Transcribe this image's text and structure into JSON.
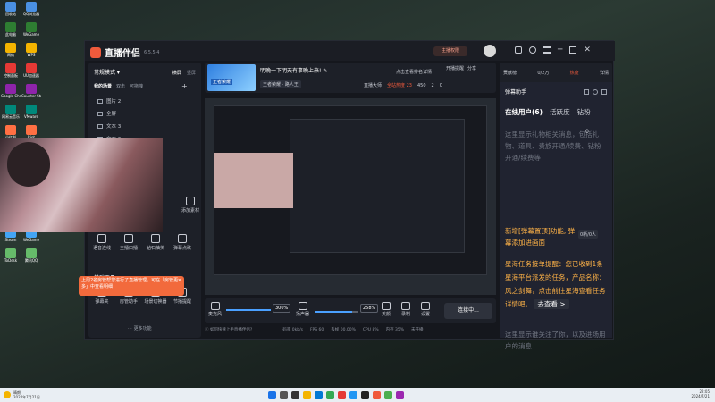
{
  "desktop": {
    "col1": [
      "回收站",
      "此电脑",
      "网络",
      "控制面板",
      "Google Chrome",
      "网易云音乐",
      "小红书",
      "Logitech G HUB",
      "Microsoft Edge",
      "OBS Studio",
      "QQ音乐",
      "Steam",
      "ToDesk"
    ],
    "col2": [
      "QQ浏览器",
      "WeGame",
      "WPS",
      "UU加速器",
      "Counter-Strike",
      "VMware",
      "Riot",
      "TUR2X RX",
      "腾讯会议",
      "Ai2Bridge",
      "Arknights",
      "WeGame",
      "腾讯QQ"
    ]
  },
  "app": {
    "logo": "直播伴侣",
    "version": "6.5.5.4",
    "top_btn": "主播权限",
    "mode_label": "常规模式",
    "orient": {
      "h": "横屏",
      "v": "竖屏"
    },
    "scene_tabs": [
      "我的场景",
      "双击",
      "可拖拽"
    ],
    "scenes": [
      {
        "name": "图片 2"
      },
      {
        "name": "全屏"
      },
      {
        "name": "文本 3"
      },
      {
        "name": "文本 2"
      }
    ],
    "add_source": "添加素材",
    "toolbox_row1": [
      "语音连线",
      "主播口播",
      "钻石抽奖",
      "弹幕点歌"
    ],
    "tools_header": "基础工具",
    "toolbox_row2": [
      "弹幕夹",
      "房管助手",
      "场景切换器",
      "节播提醒"
    ],
    "more_features": "更多功能",
    "notice": "上周2名房管帮您进行了直播管理，可在「房管更多」中查看明细",
    "stream": {
      "title": "明晚一下明天有事晚上来!",
      "game": "王者荣耀 · 路人王",
      "thumb_tag": "王者荣耀",
      "notify": "点击查看排名详情",
      "actions": [
        "开播提醒",
        "分享"
      ],
      "hot": "直播大师",
      "rank": "全站热度",
      "rank_val": "23",
      "viewers": "450",
      "likes": "2",
      "comments": "0"
    },
    "controls": {
      "mic": "麦克风",
      "mic_vol": "300%",
      "speaker": "扬声器",
      "speaker_vol": "258%",
      "beauty": "美颜",
      "record": "录制",
      "settings": "设置",
      "connect": "连接中..."
    },
    "status": {
      "help": "如何快速上手直播伴侣?",
      "bitrate": "码率 0kb/s",
      "fps": "FPS 60",
      "drop": "丢帧 00.00%",
      "cpu": "CPU 8%",
      "mem": "内存 35%",
      "state": "未开播"
    },
    "right": {
      "bar": [
        "贡献榜",
        "0/2万",
        "热度",
        "详情"
      ],
      "header": "弹幕助手",
      "tabs": [
        "在线用户(6)",
        "活跃度",
        "钻粉"
      ],
      "placeholder1": "这里显示礼物相关消息，包括礼物、道具、贵族开通/续费、钻粉开通/续费等",
      "counter": "0",
      "counter2": "0新/0人",
      "news": "新增[弹幕置顶]功能, 弹幕添加进画面",
      "task": "星海任务接单提醒：您已收到1条星海平台派发的任务，产品名称：风之剑舞，点击前往星海查看任务详情吧。",
      "task_link": "去查看 >",
      "placeholder2": "这里显示谁关注了你，以及进场用户的消息"
    }
  },
  "taskbar": {
    "weather": "晴朗",
    "weather_sub": "2024年7月21日 ...",
    "time": "22:05",
    "date": "2024/7/21"
  }
}
